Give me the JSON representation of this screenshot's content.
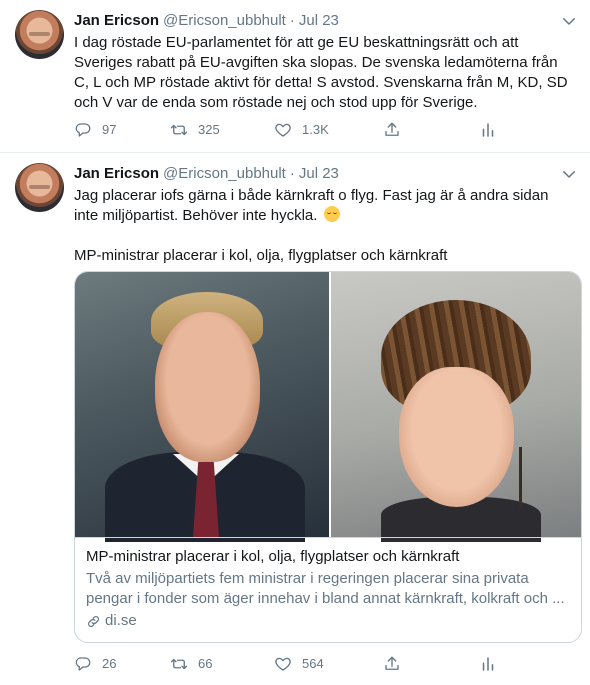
{
  "tweets": [
    {
      "author_name": "Jan Ericson",
      "handle": "@Ericson_ubbhult",
      "separator": "·",
      "date": "Jul 23",
      "text": "I dag röstade EU-parlamentet för att ge EU beskattningsrätt och att Sveriges rabatt på EU-avgiften ska slopas. De svenska ledamöterna från C, L och MP röstade aktivt för detta! S avstod. Svenskarna från M, KD, SD och V var de enda som röstade nej och stod upp för Sverige.",
      "replies": "97",
      "retweets": "325",
      "likes": "1.3K"
    },
    {
      "author_name": "Jan Ericson",
      "handle": "@Ericson_ubbhult",
      "separator": "·",
      "date": "Jul 23",
      "text": "Jag placerar iofs gärna i både kärnkraft o flyg. Fast jag är å andra sidan inte miljöpartist. Behöver inte hyckla.",
      "emoji": "smirking-face-icon",
      "text2": "MP-ministrar placerar i kol, olja, flygplatser och kärnkraft",
      "card": {
        "title": "MP-ministrar placerar i kol, olja, flygplatser och kärnkraft",
        "description": "Två av miljöpartiets fem ministrar i regeringen placerar sina privata pengar i fonder som äger innehav i bland annat kärnkraft, kolkraft och ...",
        "domain": "di.se"
      },
      "replies": "26",
      "retweets": "66",
      "likes": "564"
    }
  ],
  "colors": {
    "text": "#14171a",
    "secondary": "#657786",
    "border": "#e6ecf0"
  }
}
